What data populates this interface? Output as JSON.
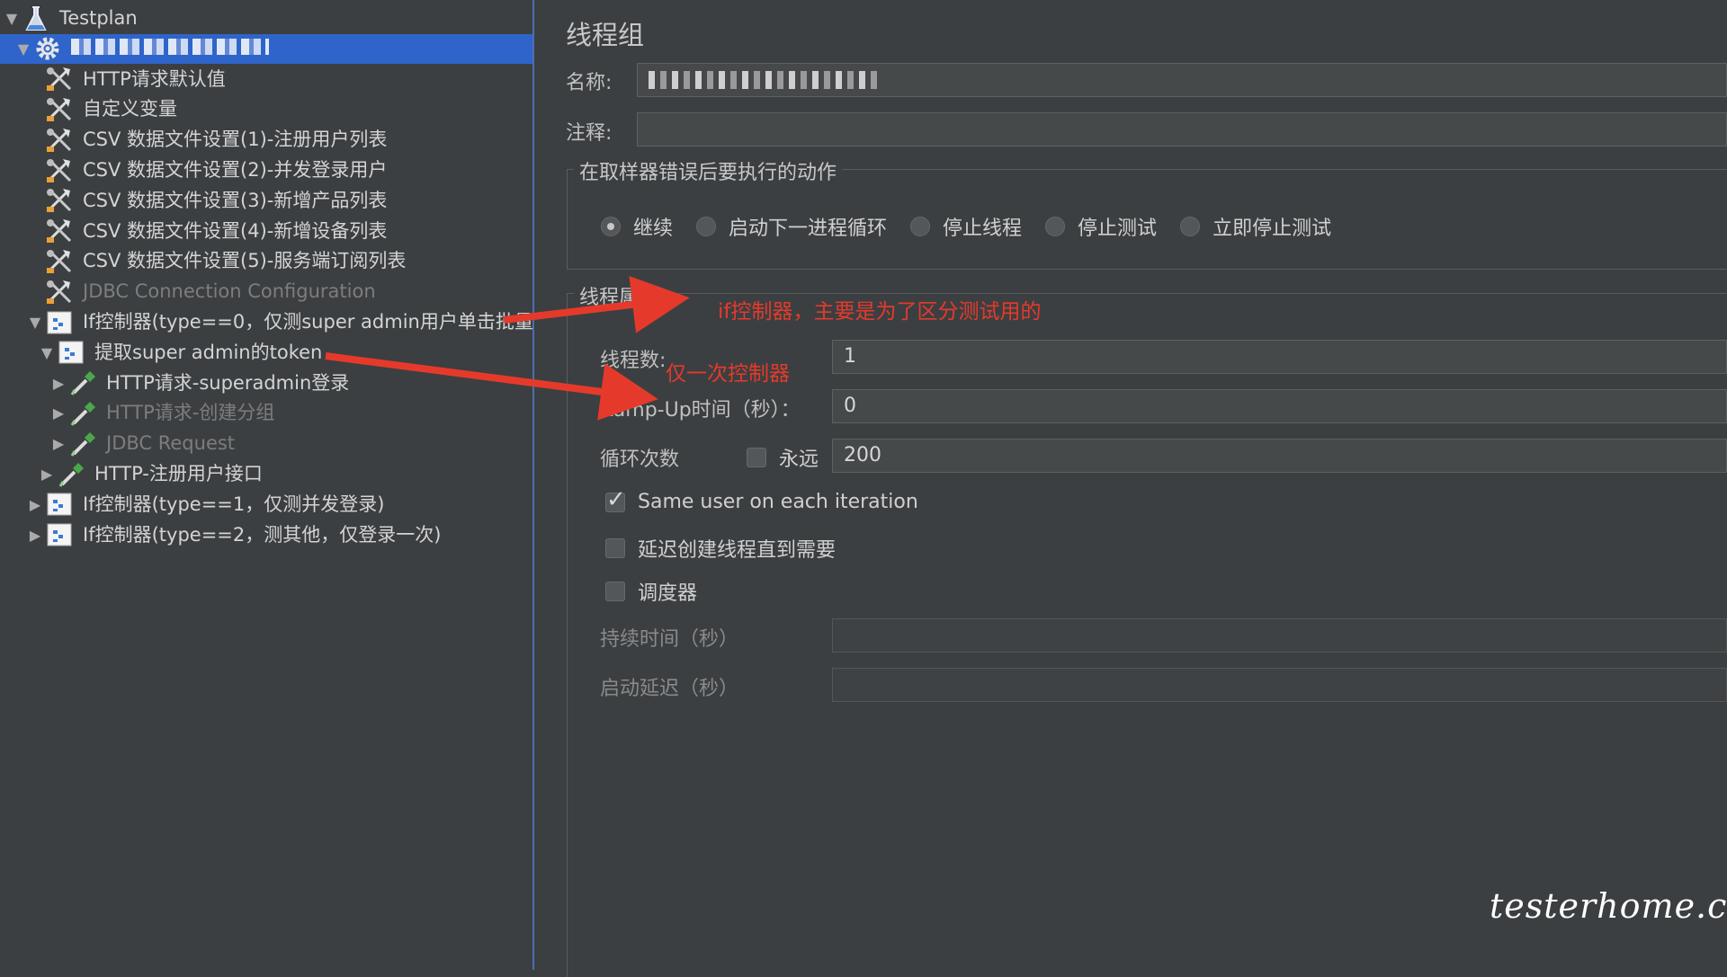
{
  "tree": [
    {
      "label": "Testplan",
      "icon": "flask-icon",
      "arrow": "▼",
      "indent": 0,
      "disabled": false
    },
    {
      "label": "",
      "icon": "gear-icon",
      "arrow": "▼",
      "indent": 1,
      "selected": true,
      "blurred": true
    },
    {
      "label": "HTTP请求默认值",
      "icon": "config-element-icon",
      "arrow": "",
      "indent": 2
    },
    {
      "label": "自定义变量",
      "icon": "config-element-icon",
      "arrow": "",
      "indent": 2
    },
    {
      "label": "CSV 数据文件设置(1)-注册用户列表",
      "icon": "config-element-icon",
      "arrow": "",
      "indent": 2
    },
    {
      "label": "CSV 数据文件设置(2)-并发登录用户",
      "icon": "config-element-icon",
      "arrow": "",
      "indent": 2
    },
    {
      "label": "CSV 数据文件设置(3)-新增产品列表",
      "icon": "config-element-icon",
      "arrow": "",
      "indent": 2
    },
    {
      "label": "CSV 数据文件设置(4)-新增设备列表",
      "icon": "config-element-icon",
      "arrow": "",
      "indent": 2
    },
    {
      "label": "CSV 数据文件设置(5)-服务端订阅列表",
      "icon": "config-element-icon",
      "arrow": "",
      "indent": 2
    },
    {
      "label": "JDBC Connection Configuration",
      "icon": "config-element-icon",
      "arrow": "",
      "indent": 2,
      "disabled": true
    },
    {
      "label": "If控制器(type==0，仅测super admin用户单击批量",
      "icon": "controller-icon",
      "arrow": "▼",
      "indent": 2
    },
    {
      "label": "提取super admin的token",
      "icon": "controller-icon",
      "arrow": "▼",
      "indent": 3
    },
    {
      "label": "HTTP请求-superadmin登录",
      "icon": "sampler-pipette-icon",
      "arrow": "▶",
      "indent": 4
    },
    {
      "label": "HTTP请求-创建分组",
      "icon": "sampler-pipette-icon",
      "arrow": "▶",
      "indent": 4,
      "disabled": true
    },
    {
      "label": "JDBC Request",
      "icon": "sampler-pipette-icon",
      "arrow": "▶",
      "indent": 4,
      "disabled": true
    },
    {
      "label": "HTTP-注册用户接口",
      "icon": "sampler-pipette-icon",
      "arrow": "▶",
      "indent": 3
    },
    {
      "label": "If控制器(type==1，仅测并发登录)",
      "icon": "controller-icon",
      "arrow": "▶",
      "indent": 2
    },
    {
      "label": "If控制器(type==2，测其他，仅登录一次)",
      "icon": "controller-icon",
      "arrow": "▶",
      "indent": 2
    }
  ],
  "panel": {
    "title": "线程组",
    "name_label": "名称:",
    "comment_label": "注释:",
    "comment_value": "",
    "error_group_title": "在取样器错误后要执行的动作",
    "error_options": [
      "继续",
      "启动下一进程循环",
      "停止线程",
      "停止测试",
      "立即停止测试"
    ],
    "error_selected": "继续",
    "props_group_title": "线程属性",
    "threads_label": "线程数:",
    "threads_value": "1",
    "rampup_label": "Ramp-Up时间（秒）：",
    "rampup_value": "0",
    "loop_label": "循环次数",
    "forever_label": "永远",
    "forever_checked": false,
    "loop_value": "200",
    "same_user_label": "Same user on each iteration",
    "same_user_checked": true,
    "delay_label": "延迟创建线程直到需要",
    "delay_checked": false,
    "scheduler_label": "调度器",
    "scheduler_checked": false,
    "duration_label": "持续时间（秒）",
    "duration_value": "",
    "startup_delay_label": "启动延迟（秒）",
    "startup_delay_value": ""
  },
  "annotations": {
    "if_controller": "if控制器，主要是为了区分测试用的",
    "once_only": "仅一次控制器",
    "color": "#e53a2b"
  },
  "watermark": "testerhome.com",
  "colors": {
    "background": "#3c3f41",
    "selection": "#2f65ca",
    "field": "#45494a"
  }
}
